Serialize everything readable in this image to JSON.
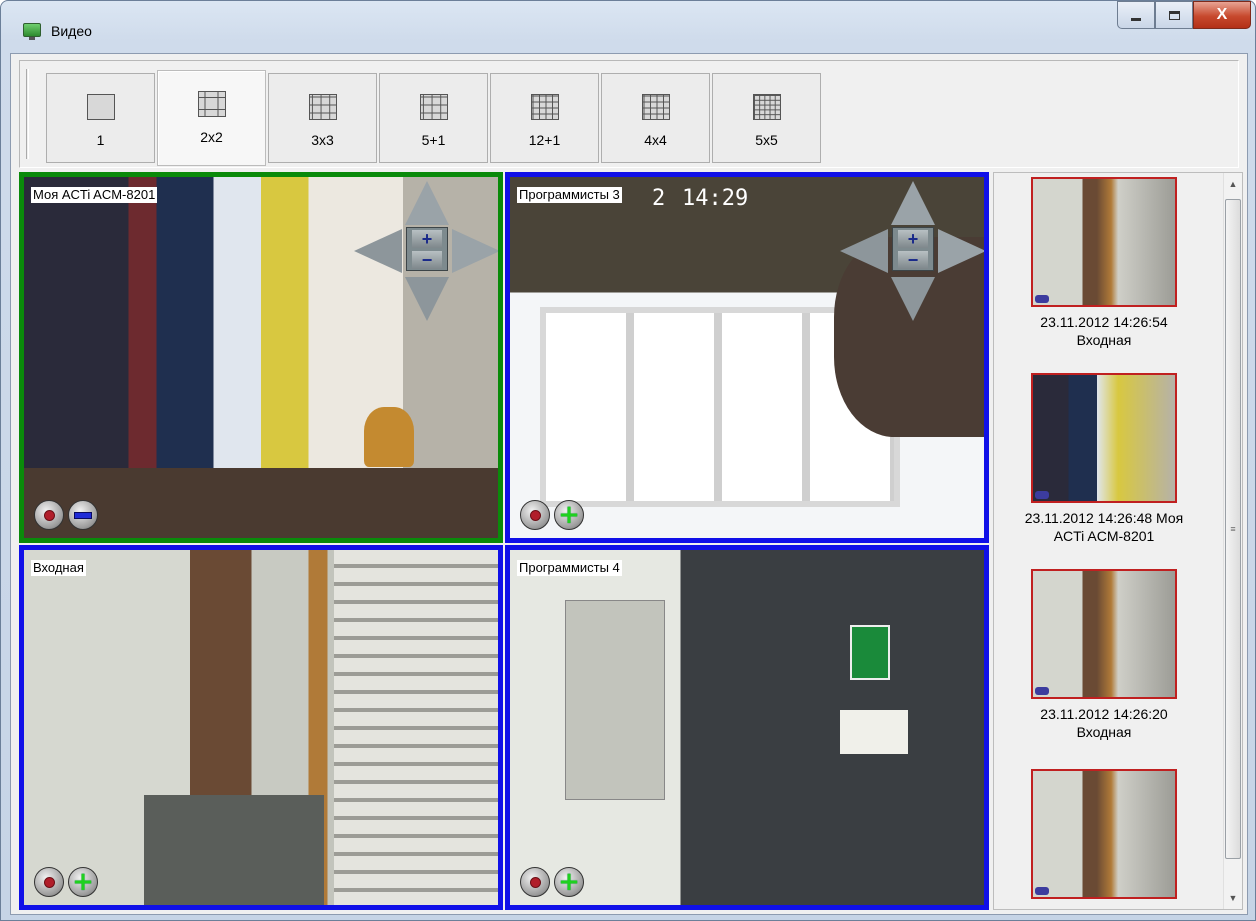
{
  "window": {
    "title": "Видео",
    "icon": "monitor-icon",
    "controls": {
      "minimize": "minimize-icon",
      "maximize": "maximize-icon",
      "close": "close-icon",
      "close_glyph": "X"
    }
  },
  "toolbar": {
    "layouts": [
      {
        "label": "1",
        "icon": "layout-1-icon",
        "grid": [
          1,
          1
        ]
      },
      {
        "label": "2x2",
        "icon": "layout-2x2-icon",
        "grid": [
          2,
          2
        ],
        "active": true
      },
      {
        "label": "3x3",
        "icon": "layout-3x3-icon",
        "grid": [
          3,
          3
        ]
      },
      {
        "label": "5+1",
        "icon": "layout-5plus1-icon",
        "grid": [
          3,
          3
        ]
      },
      {
        "label": "12+1",
        "icon": "layout-12plus1-icon",
        "grid": [
          4,
          4
        ]
      },
      {
        "label": "4x4",
        "icon": "layout-4x4-icon",
        "grid": [
          4,
          4
        ]
      },
      {
        "label": "5x5",
        "icon": "layout-5x5-icon",
        "grid": [
          5,
          5
        ]
      }
    ]
  },
  "cameras": [
    {
      "label": "Моя ACTi ACM-8201",
      "selected": true,
      "zoom_action": "minus",
      "ptz": true
    },
    {
      "label": "Программисты 3",
      "overlay_time": "14:29",
      "overlay_date_partial": "2",
      "zoom_action": "plus",
      "ptz": true
    },
    {
      "label": "Входная",
      "zoom_action": "plus",
      "ptz": false
    },
    {
      "label": "Программисты 4",
      "zoom_action": "plus",
      "ptz": false
    }
  ],
  "ptz_controls": {
    "zoom_in": "+",
    "zoom_out": "−"
  },
  "events": [
    {
      "caption_line1": "23.11.2012 14:26:54",
      "caption_line2": "Входная"
    },
    {
      "caption_line1": "23.11.2012 14:26:48 Моя",
      "caption_line2": "ACTi ACM-8201"
    },
    {
      "caption_line1": "23.11.2012 14:26:20",
      "caption_line2": "Входная"
    },
    {
      "caption_line1": "",
      "caption_line2": ""
    }
  ],
  "scrollbar": {
    "up": "▲",
    "down": "▼",
    "grip": "≡"
  },
  "colors": {
    "selected_border": "#0a8a0a",
    "tile_border": "#1010e8",
    "event_border": "#c02020",
    "record": "#b11e2a",
    "zoom_in": "#1fd11f",
    "zoom_out": "#1f2bd6"
  }
}
